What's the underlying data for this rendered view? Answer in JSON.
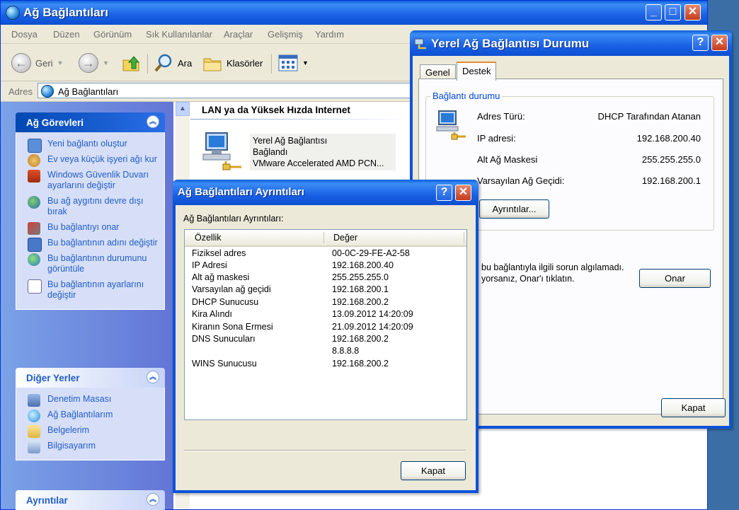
{
  "explorer": {
    "title": "Ağ Bağlantıları",
    "menu": [
      "Dosya",
      "Düzen",
      "Görünüm",
      "Sık Kullanılanlar",
      "Araçlar",
      "Gelişmiş",
      "Yardım"
    ],
    "toolbar": {
      "back": "Geri",
      "search": "Ara",
      "folders": "Klasörler"
    },
    "address": {
      "label": "Adres",
      "value": "Ağ Bağlantıları"
    },
    "tasks_panel": {
      "title": "Ağ Görevleri",
      "items": [
        "Yeni bağlantı oluştur",
        "Ev veya küçük işyeri ağı kur",
        "Windows Güvenlik Duvarı ayarlarını değiştir",
        "Bu ağ aygıtını devre dışı bırak",
        "Bu bağlantıyı onar",
        "Bu bağlantının adını değiştir",
        "Bu bağlantının durumunu görüntüle",
        "Bu bağlantının ayarlarını değiştir"
      ]
    },
    "other_places": {
      "title": "Diğer Yerler",
      "items": [
        "Denetim Masası",
        "Ağ Bağlantılarım",
        "Belgelerim",
        "Bilgisayarım"
      ]
    },
    "details_panel": {
      "title": "Ayrıntılar"
    },
    "content": {
      "group_title": "LAN ya da Yüksek Hızda Internet",
      "connection": {
        "name": "Yerel Ağ Bağlantısı",
        "status": "Bağlandı",
        "device": "VMware Accelerated AMD PCN..."
      }
    }
  },
  "status_window": {
    "title": "Yerel Ağ Bağlantısı Durumu",
    "tabs": [
      "Genel",
      "Destek"
    ],
    "active_tab": "Destek",
    "group_title": "Bağlantı durumu",
    "rows": [
      {
        "label": "Adres Türü:",
        "value": "DHCP Tarafından Atanan"
      },
      {
        "label": "IP adresi:",
        "value": "192.168.200.40"
      },
      {
        "label": "Alt Ağ Maskesi",
        "value": "255.255.255.0"
      },
      {
        "label": "Varsayılan Ağ Geçidi:",
        "value": "192.168.200.1"
      }
    ],
    "details_button": "Ayrıntılar...",
    "repair_text_1": "bu bağlantıyla ilgili sorun algılamadı.",
    "repair_text_2": "yorsanız, Onar'ı tıklatın.",
    "repair_button": "Onar",
    "close_button": "Kapat"
  },
  "details_dialog": {
    "title": "Ağ Bağlantıları Ayrıntıları",
    "caption": "Ağ Bağlantıları Ayrıntıları:",
    "columns": [
      "Özellik",
      "Değer"
    ],
    "rows": [
      {
        "property": "Fiziksel adres",
        "value": "00-0C-29-FE-A2-58"
      },
      {
        "property": "IP Adresi",
        "value": "192.168.200.40"
      },
      {
        "property": "Alt ağ maskesi",
        "value": "255.255.255.0"
      },
      {
        "property": "Varsayılan ağ geçidi",
        "value": "192.168.200.1"
      },
      {
        "property": "DHCP Sunucusu",
        "value": "192.168.200.2"
      },
      {
        "property": "Kira Alındı",
        "value": "13.09.2012 14:20:09"
      },
      {
        "property": "Kiranın Sona Ermesi",
        "value": "21.09.2012 14:20:09"
      },
      {
        "property": "DNS Sunucuları",
        "value": "192.168.200.2"
      },
      {
        "property": "",
        "value": "8.8.8.8"
      },
      {
        "property": "WINS Sunucusu",
        "value": "192.168.200.2"
      }
    ],
    "close_button": "Kapat"
  }
}
